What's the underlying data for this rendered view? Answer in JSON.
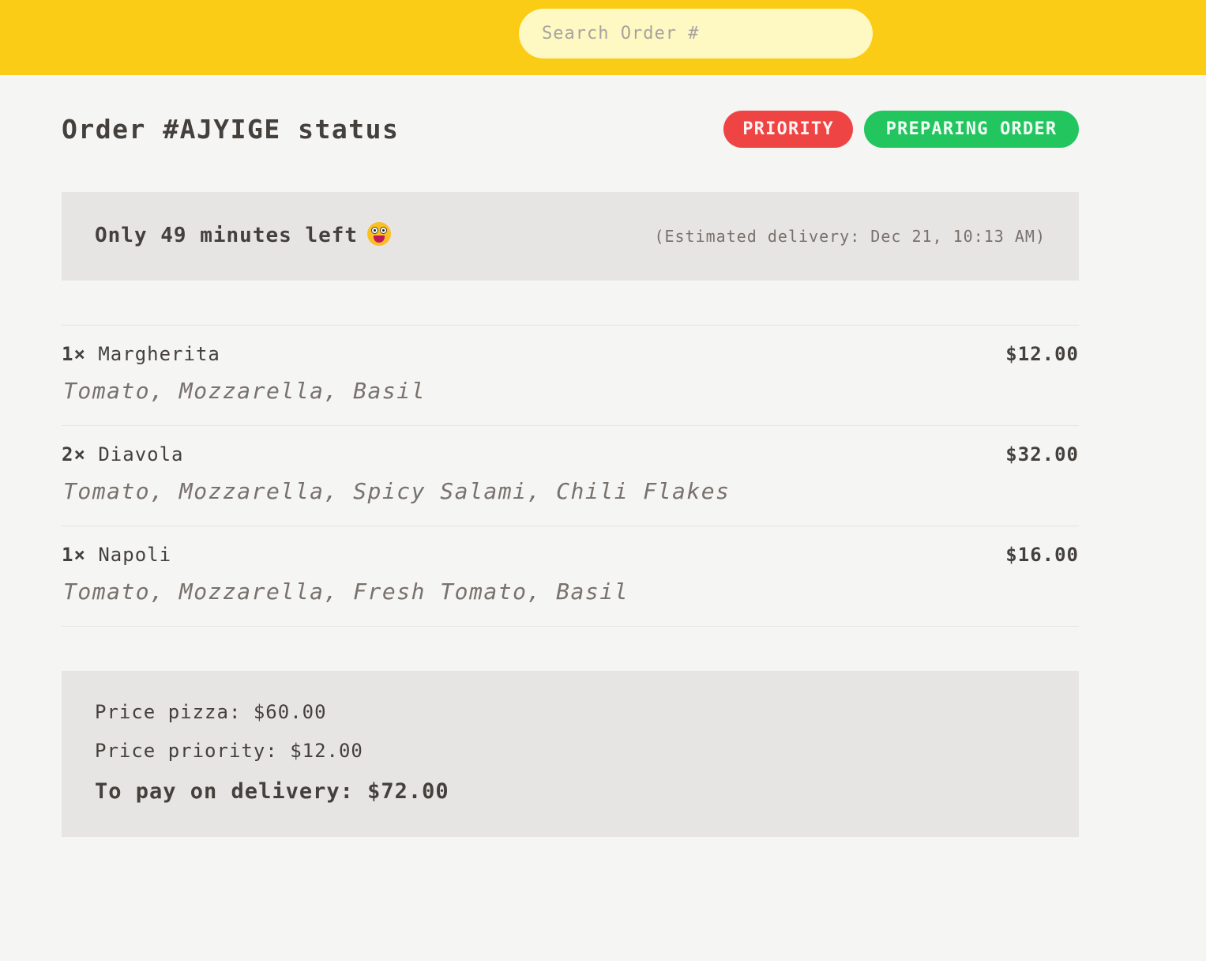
{
  "header": {
    "search_placeholder": "Search Order #"
  },
  "order": {
    "title": "Order #AJYIGE status",
    "priority_badge": "PRIORITY",
    "status_badge": "PREPARING ORDER"
  },
  "countdown": {
    "message": "Only 49 minutes left",
    "emoji": "grinning-face-icon",
    "estimated": "(Estimated delivery: Dec 21, 10:13 AM)"
  },
  "items": [
    {
      "qty": "1×",
      "name": "Margherita",
      "price": "$12.00",
      "ingredients": "Tomato, Mozzarella, Basil"
    },
    {
      "qty": "2×",
      "name": "Diavola",
      "price": "$32.00",
      "ingredients": "Tomato, Mozzarella, Spicy Salami, Chili Flakes"
    },
    {
      "qty": "1×",
      "name": "Napoli",
      "price": "$16.00",
      "ingredients": "Tomato, Mozzarella, Fresh Tomato, Basil"
    }
  ],
  "summary": {
    "price_pizza": "Price pizza: $60.00",
    "price_priority": "Price priority: $12.00",
    "to_pay": "To pay on delivery: $72.00"
  },
  "colors": {
    "header_bg": "#facc15",
    "search_bg": "#fef9c3",
    "priority": "#ef4444",
    "status": "#22c55e",
    "panel_bg": "#e7e5e4"
  }
}
